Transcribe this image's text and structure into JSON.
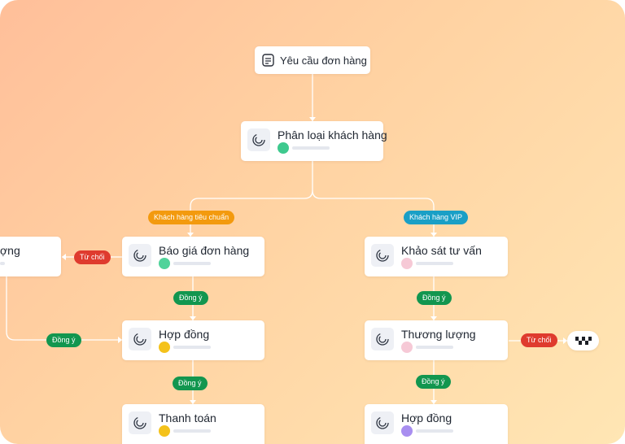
{
  "colors": {
    "orange_badge": "#f39a0e",
    "teal_badge": "#1a9fc6",
    "green_badge": "#12964f",
    "red_badge": "#df3b2e",
    "edge": "#ffffff"
  },
  "root": {
    "title": "Yêu cầu đơn hàng",
    "icon": "document-icon"
  },
  "classify": {
    "title": "Phân loại khách hàng"
  },
  "branches": {
    "standard": "Khách hàng tiêu chuẩn",
    "vip": "Khách hàng VIP"
  },
  "left": {
    "partial": {
      "title": "ợng"
    },
    "quote": {
      "title": "Báo giá đơn hàng"
    },
    "contract": {
      "title": "Hợp đồng"
    },
    "payment": {
      "title": "Thanh toán"
    },
    "reject": "Từ chối",
    "agree_1": "Đồng ý",
    "agree_side": "Đồng ý",
    "agree_2": "Đồng ý"
  },
  "right": {
    "survey": {
      "title": "Khảo sát tư vấn"
    },
    "negotiate": {
      "title": "Thương lượng"
    },
    "contract": {
      "title": "Hợp đồng"
    },
    "agree_1": "Đồng ý",
    "agree_2": "Đồng ý",
    "reject": "Từ chối",
    "end_icon": "checkered-flag-icon"
  },
  "avatars": {
    "classify": "#3ec98e",
    "quote": "#4fd39a",
    "contract_left": "#f4c21b",
    "payment": "#f4c21b",
    "survey": "#f6c9d6",
    "negotiate": "#f6c9d6",
    "contract_right": "#a88ef0"
  }
}
